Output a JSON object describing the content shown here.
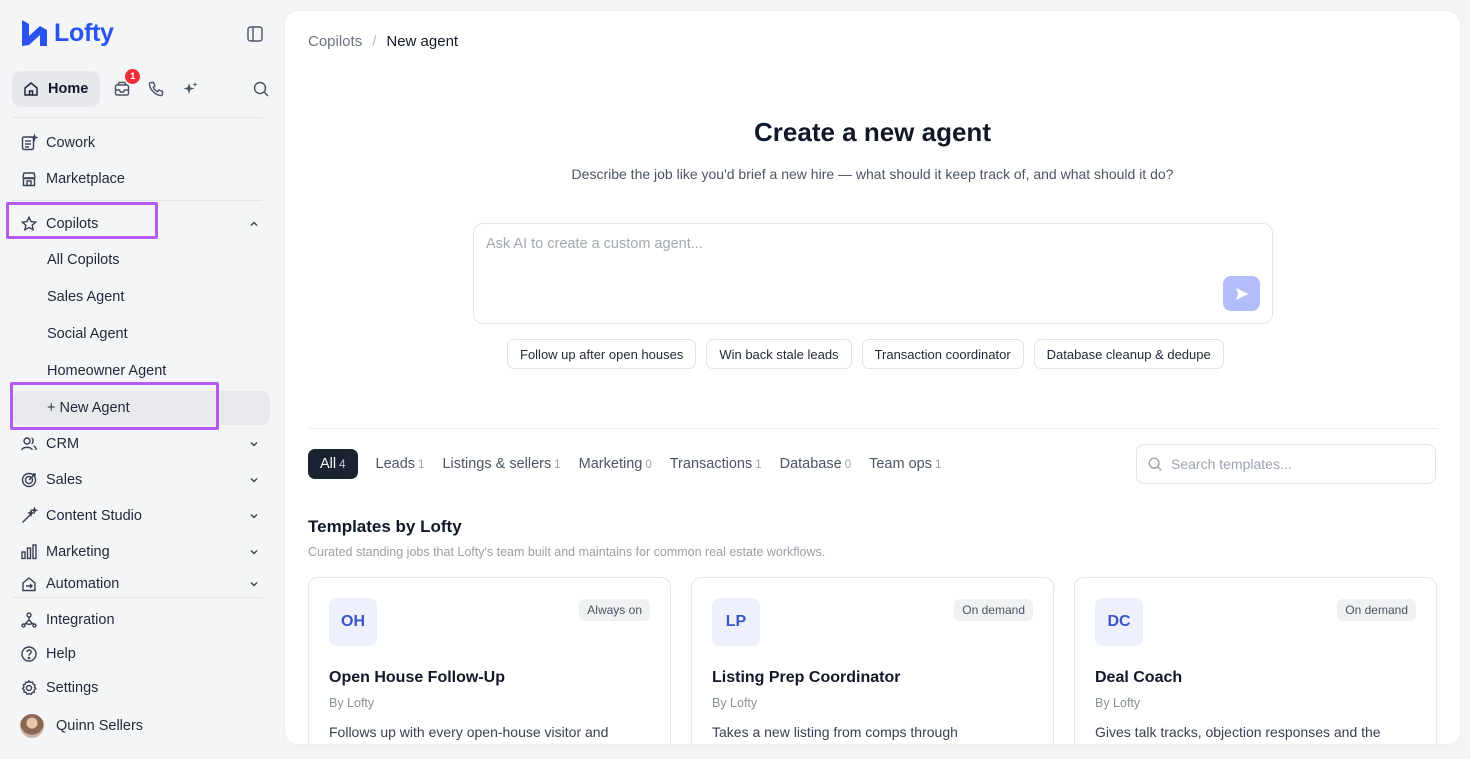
{
  "app": {
    "name": "Lofty",
    "brand_color": "#2a52f0",
    "highlight_color": "#b55cf0"
  },
  "top_nav": {
    "home_label": "Home",
    "inbox_badge": "1",
    "icons": [
      "home-icon",
      "inbox-icon",
      "phone-icon",
      "sparkle-icon",
      "search-icon",
      "sidebar-toggle-icon"
    ]
  },
  "sidebar": {
    "cowork": "Cowork",
    "marketplace": "Marketplace",
    "copilots": "Copilots",
    "copilot_items": [
      "All Copilots",
      "Sales Agent",
      "Social Agent",
      "Homeowner Agent",
      "+ New Agent"
    ],
    "crm": "CRM",
    "sales": "Sales",
    "content_studio": "Content Studio",
    "marketing": "Marketing",
    "automation": "Automation",
    "integration": "Integration",
    "help": "Help",
    "settings": "Settings",
    "user_name": "Quinn Sellers"
  },
  "breadcrumb": {
    "parent": "Copilots",
    "separator": "/",
    "current": "New agent"
  },
  "hero": {
    "title": "Create a new agent",
    "subtitle": "Describe the job like you'd brief a new hire — what should it keep track of, and what should it do?",
    "prompt_placeholder": "Ask AI to create a custom agent...",
    "prompt_value": ""
  },
  "suggestions": [
    "Follow up after open houses",
    "Win back stale leads",
    "Transaction coordinator",
    "Database cleanup & dedupe"
  ],
  "tabs": [
    {
      "label": "All",
      "count": "4",
      "active": true
    },
    {
      "label": "Leads",
      "count": "1"
    },
    {
      "label": "Listings & sellers",
      "count": "1"
    },
    {
      "label": "Marketing",
      "count": "0"
    },
    {
      "label": "Transactions",
      "count": "1"
    },
    {
      "label": "Database",
      "count": "0"
    },
    {
      "label": "Team ops",
      "count": "1"
    }
  ],
  "search": {
    "placeholder": "Search templates..."
  },
  "templates_section": {
    "title": "Templates by Lofty",
    "subtitle": "Curated standing jobs that Lofty's team built and maintains for common real estate workflows.",
    "cards": [
      {
        "initials": "OH",
        "status": "Always on",
        "title": "Open House Follow-Up",
        "by": "By Lofty",
        "desc": "Follows up with every open-house visitor and"
      },
      {
        "initials": "LP",
        "status": "On demand",
        "title": "Listing Prep Coordinator",
        "by": "By Lofty",
        "desc": "Takes a new listing from comps through"
      },
      {
        "initials": "DC",
        "status": "On demand",
        "title": "Deal Coach",
        "by": "By Lofty",
        "desc": "Gives talk tracks, objection responses and the"
      }
    ]
  }
}
